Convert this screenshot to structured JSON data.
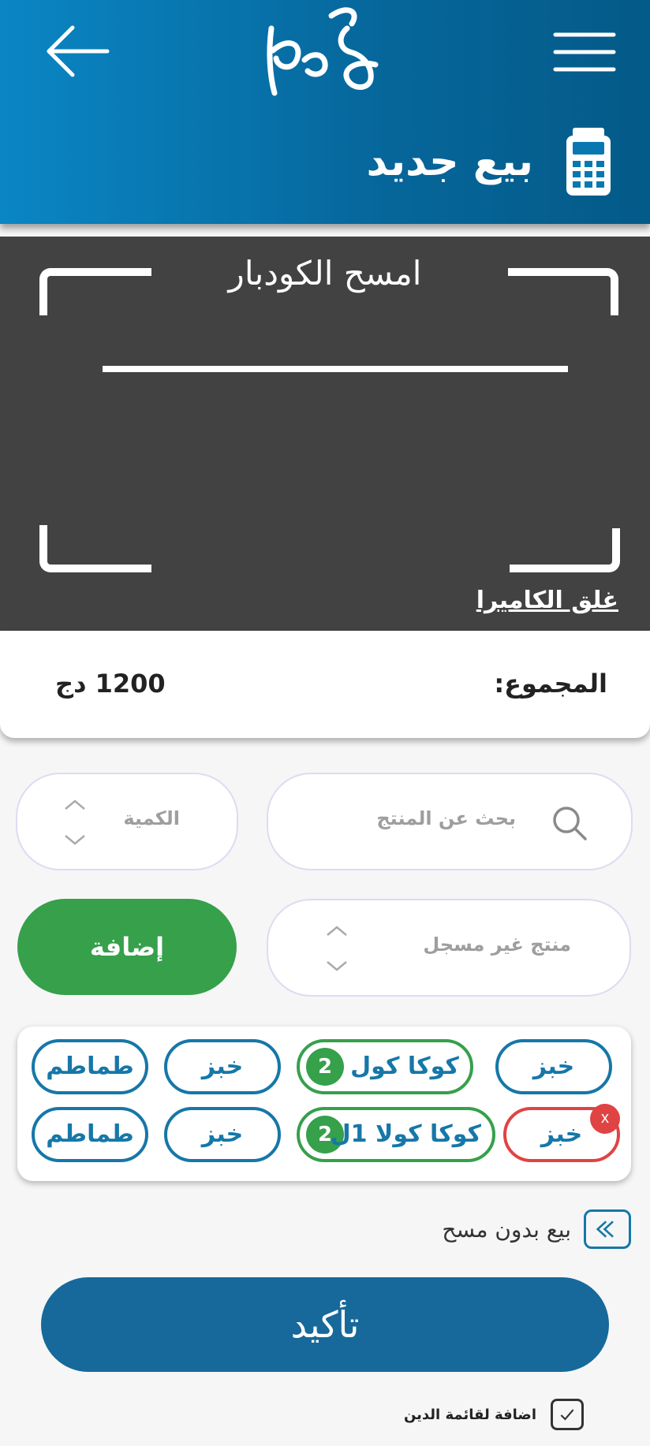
{
  "header": {
    "page_title": "بيع جديد",
    "colors": {
      "gradient_start": "#0a86c4",
      "gradient_end": "#045a88"
    }
  },
  "scanner": {
    "label": "امسح الكودبار",
    "close_camera": "غلق الكاميرا"
  },
  "total": {
    "label": "المجموع:",
    "value": "1200 دج"
  },
  "form": {
    "quantity_placeholder": "الكمية",
    "search_placeholder": "بحث عن المنتج",
    "unregistered_placeholder": "منتج غير مسجل",
    "add_label": "إضافة"
  },
  "items": [
    {
      "label": "خبز"
    },
    {
      "label": "كوكا كول",
      "count": "2"
    },
    {
      "label": "خبز"
    },
    {
      "label": "طماطم"
    },
    {
      "label": "خبز",
      "remove": "x"
    },
    {
      "label": "كوكا كولا 1ل",
      "count": "2"
    },
    {
      "label": "خبز"
    },
    {
      "label": "طماطم"
    }
  ],
  "no_scan_label": "بيع بدون مسح",
  "confirm_label": "تأكيد",
  "debt_label": "اضافة لقائمة الدين",
  "colors": {
    "primary": "#16699a",
    "chip_blue": "#1677a8",
    "green": "#36a04b",
    "red": "#e04343",
    "camera_bg": "#424242"
  }
}
